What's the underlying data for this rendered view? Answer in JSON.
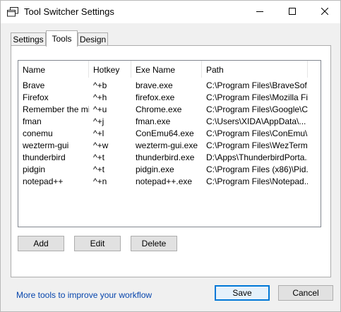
{
  "window": {
    "title": "Tool Switcher Settings"
  },
  "titlebar": {
    "icon": "window-switch-icon",
    "minimize": "minimize-icon",
    "maximize": "maximize-icon",
    "close": "close-icon"
  },
  "tabs": [
    {
      "label": "Settings",
      "active": false
    },
    {
      "label": "Tools",
      "active": true
    },
    {
      "label": "Design",
      "active": false
    }
  ],
  "table": {
    "columns": [
      "Name",
      "Hotkey",
      "Exe Name",
      "Path"
    ],
    "rows": [
      [
        "Brave",
        "^+b",
        "brave.exe",
        "C:\\Program Files\\BraveSof..."
      ],
      [
        "Firefox",
        "^+h",
        "firefox.exe",
        "C:\\Program Files\\Mozilla Fir..."
      ],
      [
        "Remember the milk",
        "^+u",
        "Chrome.exe",
        "C:\\Program Files\\Google\\C..."
      ],
      [
        "fman",
        "^+j",
        "fman.exe",
        "C:\\Users\\XIDA\\AppData\\..."
      ],
      [
        "conemu",
        "^+l",
        "ConEmu64.exe",
        "C:\\Program Files\\ConEmu\\..."
      ],
      [
        "wezterm-gui",
        "^+w",
        "wezterm-gui.exe",
        "C:\\Program Files\\WezTerm..."
      ],
      [
        "thunderbird",
        "^+t",
        "thunderbird.exe",
        "D:\\Apps\\ThunderbirdPorta..."
      ],
      [
        "pidgin",
        "^+t",
        "pidgin.exe",
        "C:\\Program Files (x86)\\Pid..."
      ],
      [
        "notepad++",
        "^+n",
        "notepad++.exe",
        "C:\\Program Files\\Notepad..."
      ]
    ]
  },
  "buttons": {
    "add": "Add",
    "edit": "Edit",
    "delete": "Delete",
    "save": "Save",
    "cancel": "Cancel"
  },
  "footer": {
    "link": "More tools to improve your workflow"
  },
  "colors": {
    "link": "#0645ad",
    "accent": "#0078d7"
  }
}
